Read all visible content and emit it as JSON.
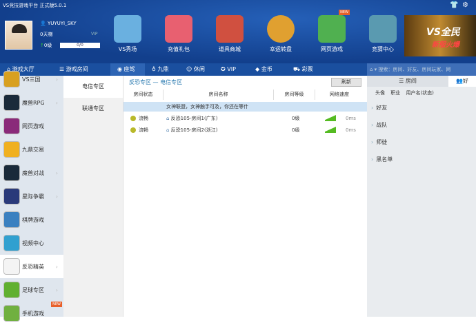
{
  "window": {
    "title": "VS竞技游戏平台 正式版5.0.1",
    "icons": [
      "shirt-icon",
      "gear-icon"
    ]
  },
  "user": {
    "name": "YUYUYI_SKY",
    "ladder": "0天梯",
    "level": "0级",
    "progress": "0/0",
    "progress_fraction": 0,
    "vip": "VIP"
  },
  "tools": [
    {
      "label": "VS秀场",
      "icon": "microphone-icon"
    },
    {
      "label": "充值礼包",
      "icon": "gift-icon"
    },
    {
      "label": "道具商城",
      "icon": "shop-icon"
    },
    {
      "label": "幸运转盘",
      "icon": "wheel-icon"
    },
    {
      "label": "网页游戏",
      "icon": "gamepad-icon",
      "badge": "NEW"
    },
    {
      "label": "竞猜中心",
      "icon": "quiz-icon"
    }
  ],
  "banner": {
    "text": "VS全民",
    "subtext": "新服火爆"
  },
  "nav": [
    {
      "label": "游戏大厅",
      "icon": "⌂"
    },
    {
      "label": "游戏房间",
      "icon": "☰"
    },
    {
      "label": "座驾",
      "icon": "◉"
    },
    {
      "label": "九鼎",
      "icon": "♁"
    },
    {
      "label": "休闲",
      "icon": "☺"
    },
    {
      "label": "VIP",
      "icon": "✪"
    },
    {
      "label": "金币",
      "icon": "◆"
    },
    {
      "label": "彩票",
      "icon": "⛟"
    }
  ],
  "search": {
    "placeholder": "搜索：房间、好友、房间玩家、网"
  },
  "sidebar": [
    {
      "label": "VS三国",
      "color": "#d8a020"
    },
    {
      "label": "魔兽RPG",
      "color": "#1a2a3a"
    },
    {
      "label": "网页游戏",
      "color": "#8a2a7a"
    },
    {
      "label": "九鼎交易",
      "color": "#f0b020"
    },
    {
      "label": "魔兽对战",
      "color": "#1a2a3a"
    },
    {
      "label": "星际争霸",
      "color": "#2a3a7a"
    },
    {
      "label": "棋牌游戏",
      "color": "#3a80c0"
    },
    {
      "label": "视频中心",
      "color": "#30a0d0"
    },
    {
      "label": "反恐精英",
      "color": "#f4f4f4"
    },
    {
      "label": "足球专区",
      "color": "#60b030"
    },
    {
      "label": "手机游戏",
      "color": "#70b040",
      "badge": "NEW"
    }
  ],
  "zones": [
    "电信专区",
    "联通专区"
  ],
  "main": {
    "breadcrumb": "反恐专区 — 电信专区",
    "refresh": "刷新",
    "columns": [
      "房间状态",
      "房间名称",
      "房间等级",
      "网络速度"
    ],
    "notice": "女神联盟，女神触手可及，你还在等什",
    "rows": [
      {
        "status": "流畅",
        "name": "反恐105-房间1(广东)",
        "level": "0级",
        "speed": "0ms"
      },
      {
        "status": "流畅",
        "name": "反恐105-房间2(浙江)",
        "level": "0级",
        "speed": "0ms"
      }
    ]
  },
  "right": {
    "tabs": [
      "房间",
      "好"
    ],
    "columns": "头像 职业 用户名(状态)",
    "groups": [
      "好友",
      "战队",
      "师徒",
      "黑名单"
    ]
  }
}
